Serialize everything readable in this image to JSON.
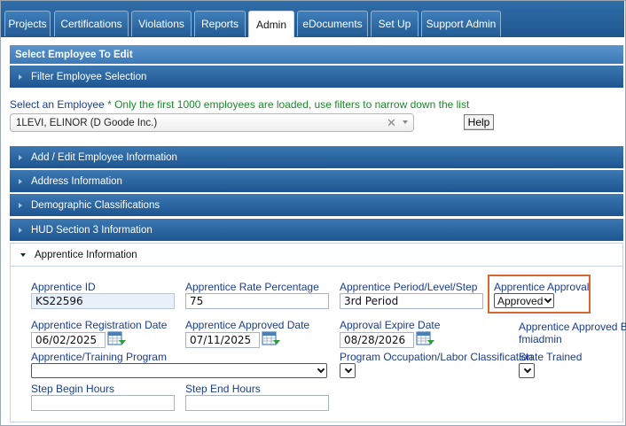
{
  "nav": {
    "tabs": [
      {
        "label": "Projects"
      },
      {
        "label": "Certifications"
      },
      {
        "label": "Violations"
      },
      {
        "label": "Reports"
      },
      {
        "label": "Admin"
      },
      {
        "label": "eDocuments"
      },
      {
        "label": "Set Up"
      },
      {
        "label": "Support Admin"
      }
    ],
    "active": "Admin"
  },
  "sections": {
    "select_employee": "Select Employee To Edit",
    "filter": "Filter Employee Selection",
    "add_edit": "Add / Edit Employee Information",
    "address": "Address Information",
    "demographic": "Demographic Classifications",
    "hud": "HUD Section 3 Information",
    "apprentice": "Apprentice Information"
  },
  "employee_select": {
    "label": "Select an Employee",
    "note": "* Only the first 1000 employees are loaded, use filters to narrow down the list",
    "value": "1LEVI, ELINOR (D Goode Inc.)",
    "help_label": "Help"
  },
  "apprentice": {
    "id_label": "Apprentice ID",
    "id_value": "KS22596",
    "rate_label": "Apprentice Rate Percentage",
    "rate_value": "75",
    "period_label": "Apprentice Period/Level/Step",
    "period_value": "3rd Period",
    "approval_label": "Apprentice Approval",
    "approval_value": "Approved",
    "reg_date_label": "Apprentice Registration Date",
    "reg_date_value": "06/02/2025",
    "approved_date_label": "Apprentice Approved Date",
    "approved_date_value": "07/11/2025",
    "expire_label": "Approval Expire Date",
    "expire_value": "08/28/2026",
    "approved_by_label": "Apprentice Approved By",
    "approved_by_value": "fmiadmin",
    "program_label": "Apprentice/Training Program",
    "program_value": "",
    "occupation_label": "Program Occupation/Labor Classification",
    "state_trained_label": "State Trained",
    "step_begin_label": "Step Begin Hours",
    "step_begin_value": "",
    "step_end_label": "Step End Hours",
    "step_end_value": ""
  },
  "colors": {
    "nav_bg": "#1f5690",
    "header_bg": "#2a66a3",
    "label_blue": "#1a3d8f",
    "note_green": "#1a8a2a",
    "highlight_orange": "#d4692f"
  }
}
